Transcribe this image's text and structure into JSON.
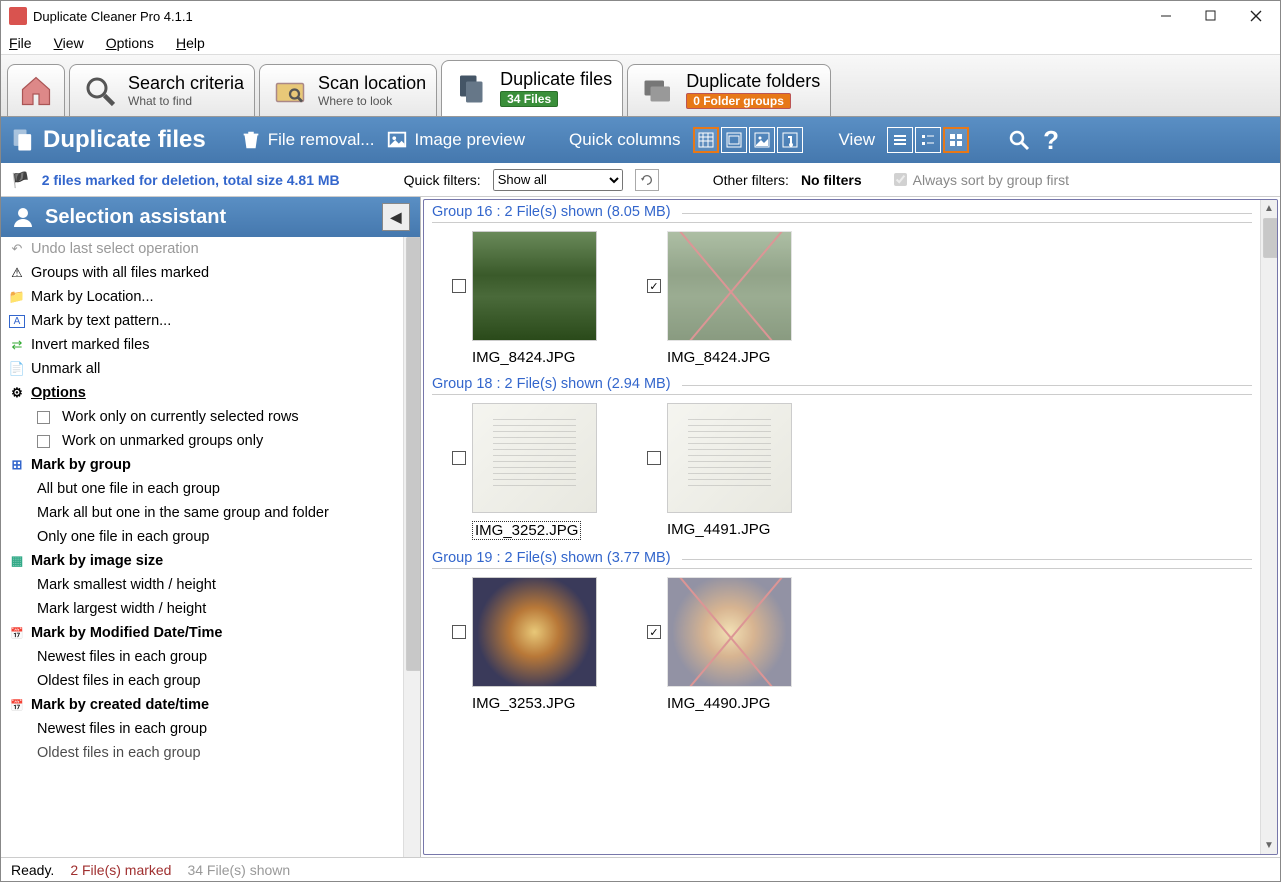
{
  "window": {
    "title": "Duplicate Cleaner Pro 4.1.1"
  },
  "menu": [
    "File",
    "View",
    "Options",
    "Help"
  ],
  "tabs": {
    "search": {
      "label": "Search criteria",
      "sub": "What to find"
    },
    "scan": {
      "label": "Scan location",
      "sub": "Where to look"
    },
    "dupfiles": {
      "label": "Duplicate files",
      "badge": "34 Files"
    },
    "dupfolders": {
      "label": "Duplicate folders",
      "badge": "0 Folder groups"
    }
  },
  "toolbar": {
    "title": "Duplicate files",
    "file_removal": "File removal...",
    "image_preview": "Image preview",
    "quick_columns": "Quick columns",
    "view": "View"
  },
  "filterbar": {
    "marked_text": "2 files marked for deletion, total size 4.81 MB",
    "quick_filters_label": "Quick filters:",
    "quick_filter_value": "Show all",
    "other_filters_label": "Other filters:",
    "no_filters": "No filters",
    "always_sort": "Always sort by group first"
  },
  "sidebar": {
    "title": "Selection assistant",
    "items": {
      "undo": "Undo last select operation",
      "groups_all": "Groups with all files marked",
      "by_location": "Mark by Location...",
      "by_pattern": "Mark by text pattern...",
      "invert": "Invert marked files",
      "unmark": "Unmark all",
      "options": "Options",
      "opt1": "Work only on currently selected rows",
      "opt2": "Work on unmarked groups only",
      "by_group": "Mark by group",
      "bg1": "All but one file in each group",
      "bg2": "Mark all but one in the same group and folder",
      "bg3": "Only one file in each group",
      "by_image": "Mark by image size",
      "bi1": "Mark smallest width / height",
      "bi2": "Mark largest width / height",
      "by_modified": "Mark by Modified Date/Time",
      "bm1": "Newest files in each group",
      "bm2": "Oldest files in each group",
      "by_created": "Mark by created date/time",
      "bc1": "Newest files in each group",
      "bc2": "Oldest files in each group"
    }
  },
  "groups": [
    {
      "header": "Group 16  :  2 File(s) shown (8.05 MB)",
      "partial": true,
      "files": [
        {
          "name": "IMG_8424.JPG",
          "checked": false,
          "kind": "garden"
        },
        {
          "name": "IMG_8424.JPG",
          "checked": true,
          "kind": "garden"
        }
      ]
    },
    {
      "header": "Group 18  :  2 File(s) shown (2.94 MB)",
      "files": [
        {
          "name": "IMG_3252.JPG",
          "checked": false,
          "kind": "doc",
          "selected": true
        },
        {
          "name": "IMG_4491.JPG",
          "checked": false,
          "kind": "doc"
        }
      ]
    },
    {
      "header": "Group 19  :  2 File(s) shown (3.77 MB)",
      "files": [
        {
          "name": "IMG_3253.JPG",
          "checked": false,
          "kind": "food"
        },
        {
          "name": "IMG_4490.JPG",
          "checked": true,
          "kind": "food"
        }
      ]
    }
  ],
  "status": {
    "s1": "Ready.",
    "s2": "2 File(s) marked",
    "s3": "34 File(s) shown"
  }
}
